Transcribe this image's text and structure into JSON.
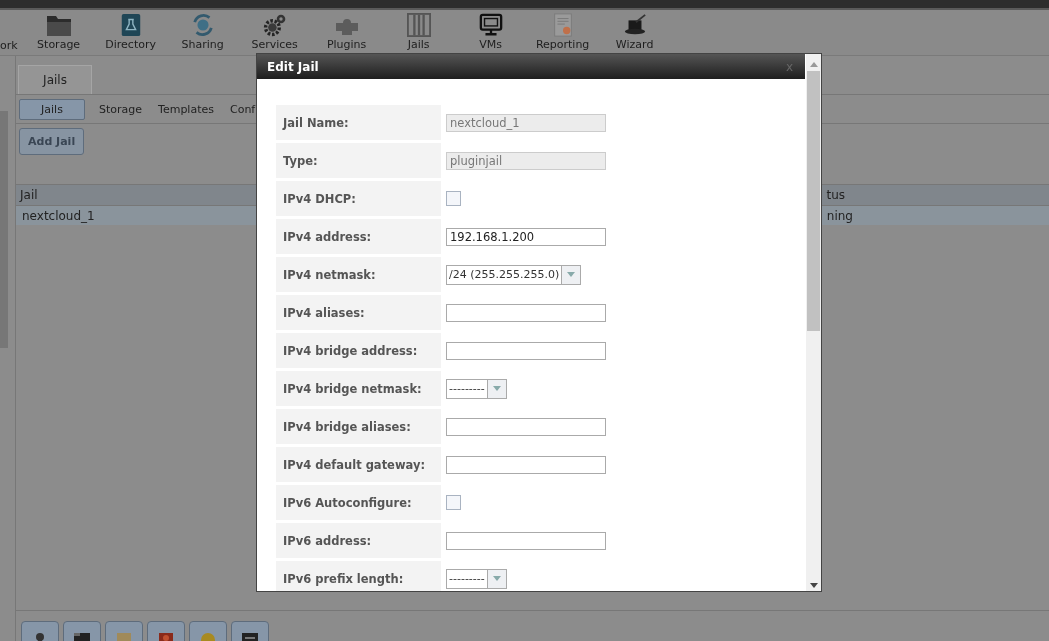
{
  "toolbar": [
    {
      "label": "ork"
    },
    {
      "label": "Storage"
    },
    {
      "label": "Directory"
    },
    {
      "label": "Sharing"
    },
    {
      "label": "Services"
    },
    {
      "label": "Plugins"
    },
    {
      "label": "Jails"
    },
    {
      "label": "VMs"
    },
    {
      "label": "Reporting"
    },
    {
      "label": "Wizard"
    }
  ],
  "tabs": [
    {
      "label": "Jails",
      "selected": true
    }
  ],
  "subtabs": [
    {
      "label": "Jails",
      "selected": true
    },
    {
      "label": "Storage",
      "selected": false
    },
    {
      "label": "Templates",
      "selected": false
    },
    {
      "label": "Conf",
      "selected": false
    }
  ],
  "add_button": "Add Jail",
  "table": {
    "columns": [
      "Jail",
      "tus"
    ],
    "rows": [
      [
        "nextcloud_1",
        "ning"
      ]
    ]
  },
  "dialog": {
    "title": "Edit Jail",
    "close": "x",
    "fields": [
      {
        "label": "Jail Name:",
        "kind": "text",
        "value": "nextcloud_1",
        "disabled": true
      },
      {
        "label": "Type:",
        "kind": "text",
        "value": "pluginjail",
        "disabled": true
      },
      {
        "label": "IPv4 DHCP:",
        "kind": "checkbox",
        "checked": false
      },
      {
        "label": "IPv4 address:",
        "kind": "text",
        "value": "192.168.1.200",
        "disabled": false
      },
      {
        "label": "IPv4 netmask:",
        "kind": "select",
        "value": "/24 (255.255.255.0)"
      },
      {
        "label": "IPv4 aliases:",
        "kind": "text",
        "disabled": false
      },
      {
        "label": "IPv4 bridge address:",
        "kind": "text",
        "disabled": false
      },
      {
        "label": "IPv4 bridge netmask:",
        "kind": "select",
        "value": "---------"
      },
      {
        "label": "IPv4 bridge aliases:",
        "kind": "text",
        "disabled": false
      },
      {
        "label": "IPv4 default gateway:",
        "kind": "text",
        "disabled": false
      },
      {
        "label": "IPv6 Autoconfigure:",
        "kind": "checkbox",
        "checked": false
      },
      {
        "label": "IPv6 address:",
        "kind": "text",
        "disabled": false
      },
      {
        "label": "IPv6 prefix length:",
        "kind": "select",
        "value": "---------"
      }
    ]
  }
}
